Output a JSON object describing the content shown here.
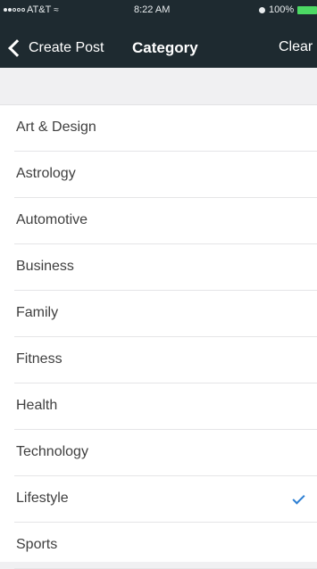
{
  "status_bar": {
    "carrier": "AT&T",
    "time": "8:22 AM",
    "battery": "100%"
  },
  "nav": {
    "back_label": "Create Post",
    "title": "Category",
    "clear_label": "Clear"
  },
  "categories": [
    {
      "label": "Art & Design",
      "selected": false
    },
    {
      "label": "Astrology",
      "selected": false
    },
    {
      "label": "Automotive",
      "selected": false
    },
    {
      "label": "Business",
      "selected": false
    },
    {
      "label": "Family",
      "selected": false
    },
    {
      "label": "Fitness",
      "selected": false
    },
    {
      "label": "Health",
      "selected": false
    },
    {
      "label": "Technology",
      "selected": false
    },
    {
      "label": "Lifestyle",
      "selected": true
    },
    {
      "label": "Sports",
      "selected": false
    }
  ],
  "colors": {
    "nav_bg": "#1e2a30",
    "checkmark": "#2d7fd3",
    "battery": "#4cd964"
  }
}
